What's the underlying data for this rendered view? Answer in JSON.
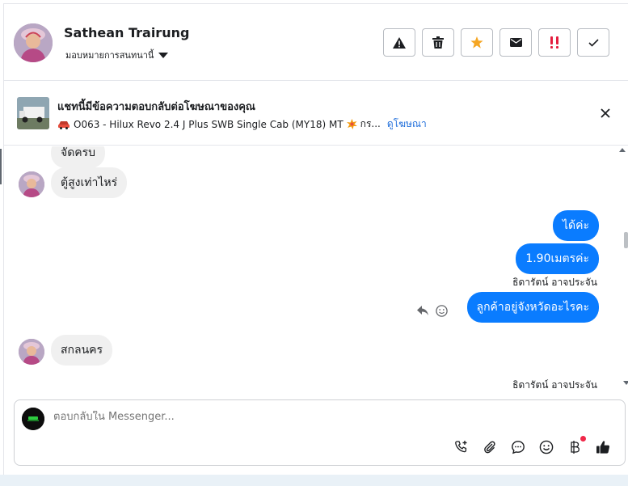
{
  "header": {
    "contact_name": "Sathean Trairung",
    "assign_label": "มอบหมายการสนทนานี้",
    "actions": [
      {
        "name": "report-spam-button",
        "icon": "warning-icon"
      },
      {
        "name": "delete-button",
        "icon": "trash-icon"
      },
      {
        "name": "star-button",
        "icon": "star-icon"
      },
      {
        "name": "mark-unread-button",
        "icon": "envelope-icon"
      },
      {
        "name": "follow-up-button",
        "icon": "double-exclamation-icon"
      },
      {
        "name": "mark-done-button",
        "icon": "check-icon"
      }
    ]
  },
  "ad_banner": {
    "title": "แชทนี้มีข้อความตอบกลับต่อโฆษณาของคุณ",
    "subtitle": "O063 - Hilux Revo 2.4 J Plus SWB Single Cab (MY18) MT",
    "subtitle_suffix": "กร...",
    "view_ad_link": "ดูโฆษณา"
  },
  "messages": [
    {
      "direction": "in",
      "text": "จัดครบ"
    },
    {
      "direction": "in",
      "text": "ตู้สูงเท่าไหร่"
    },
    {
      "direction": "out",
      "text": "ได้ค่ะ"
    },
    {
      "direction": "out",
      "text": "1.90เมตรค่ะ"
    },
    {
      "direction": "label",
      "text": "ธิดารัตน์ อาจประจัน"
    },
    {
      "direction": "out",
      "text": "ลูกค้าอยู่จังหวัดอะไรคะ"
    },
    {
      "direction": "in",
      "text": "สกลนคร"
    },
    {
      "direction": "label",
      "text": "ธิดารัตน์ อาจประจัน"
    }
  ],
  "composer": {
    "placeholder": "ตอบกลับใน Messenger...",
    "tools": [
      "add-call-icon",
      "attachment-icon",
      "saved-reply-icon",
      "emoji-icon",
      "payment-icon",
      "thumbs-up-icon"
    ]
  },
  "colors": {
    "outgoing_bubble": "#0a7cff",
    "incoming_bubble": "#f0f0f0",
    "star": "#f5a623",
    "follow_up": "#e41e3f",
    "link": "#216fdb"
  }
}
